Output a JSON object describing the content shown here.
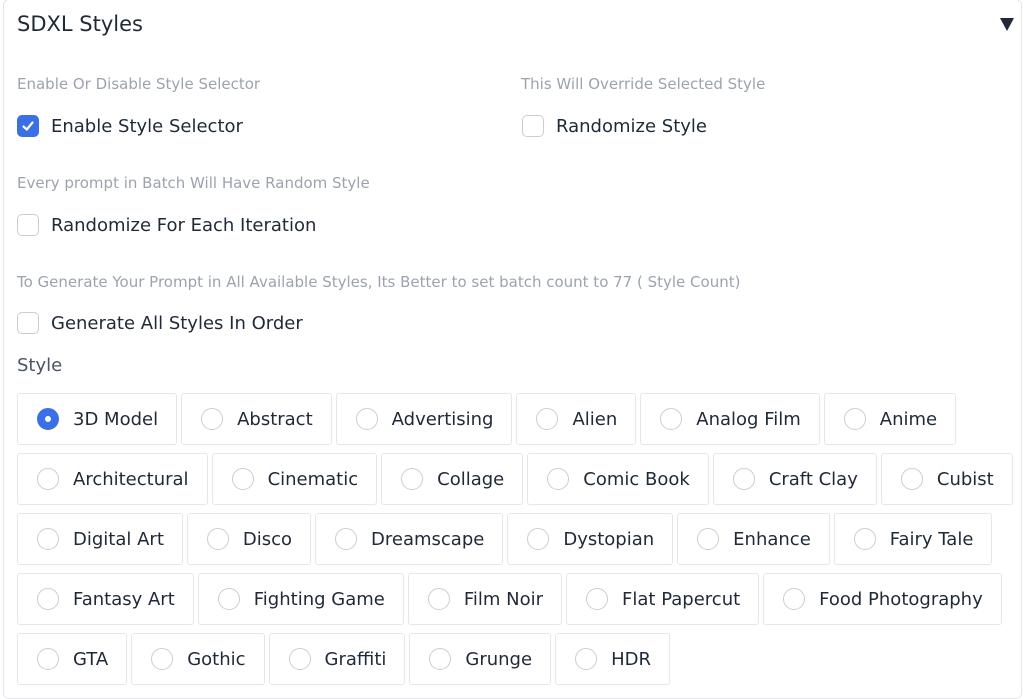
{
  "panel": {
    "title": "SDXL Styles",
    "collapse_icon": "triangle-down-icon"
  },
  "options": {
    "enable_info": "Enable Or Disable Style Selector",
    "enable_label": "Enable Style Selector",
    "enable_checked": true,
    "randomize_info": "This Will Override Selected Style",
    "randomize_label": "Randomize Style",
    "randomize_checked": false,
    "iteration_info": "Every prompt in Batch Will Have Random Style",
    "iteration_label": "Randomize For Each Iteration",
    "iteration_checked": false,
    "all_info": "To Generate Your Prompt in All Available Styles, Its Better to set batch count to 77 ( Style Count)",
    "all_label": "Generate All Styles In Order",
    "all_checked": false
  },
  "style": {
    "label": "Style",
    "selected": "3D Model",
    "options": [
      "3D Model",
      "Abstract",
      "Advertising",
      "Alien",
      "Analog Film",
      "Anime",
      "Architectural",
      "Cinematic",
      "Collage",
      "Comic Book",
      "Craft Clay",
      "Cubist",
      "Digital Art",
      "Disco",
      "Dreamscape",
      "Dystopian",
      "Enhance",
      "Fairy Tale",
      "Fantasy Art",
      "Fighting Game",
      "Film Noir",
      "Flat Papercut",
      "Food Photography",
      "GTA",
      "Gothic",
      "Graffiti",
      "Grunge",
      "HDR"
    ]
  },
  "colors": {
    "accent": "#3b6fe6",
    "border": "#e5e7eb",
    "info_text": "#9ca3af"
  }
}
